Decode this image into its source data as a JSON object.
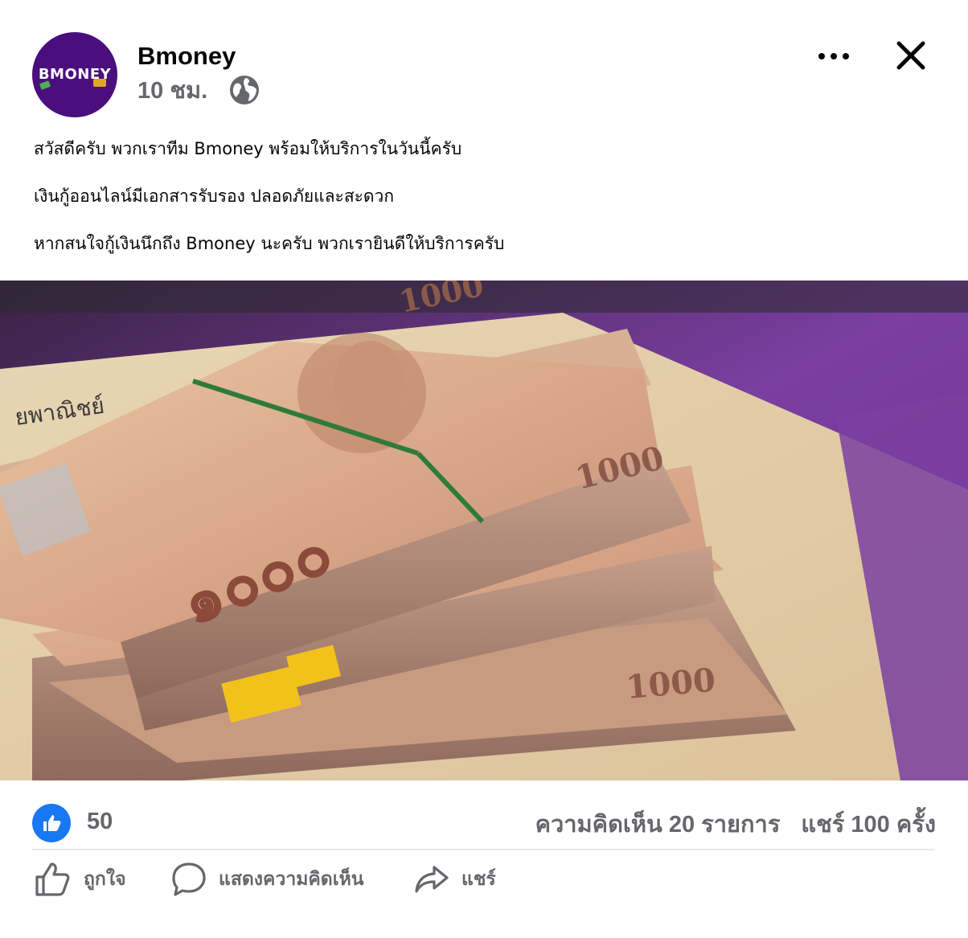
{
  "post": {
    "page_name": "Bmoney",
    "avatar_text": "BMONEY",
    "time": "10 ชม.",
    "privacy_icon": "globe-icon",
    "lines": [
      "สวัสดีครับ พวกเราทีม Bmoney พร้อมให้บริการในวันนี้ครับ",
      "เงินกู้ออนไลน์มีเอกสารรับรอง ปลอดภัยและสะดวก",
      "หากสนใจกู้เงินนึกถึง Bmoney นะครับ พวกเรายินดีให้บริการครับ"
    ]
  },
  "photo": {
    "banknote_label": "1000"
  },
  "stats": {
    "likes": "50",
    "comments": "ความคิดเห็น 20 รายการ",
    "shares": "แชร์ 100 ครั้ง"
  },
  "actions": {
    "like_label": "ถูกใจ",
    "comment_label": "แสดงความคิดเห็น",
    "share_label": "แชร์"
  },
  "colors": {
    "avatar_bg": "#4a0f7d",
    "like_blue": "#1877f2",
    "muted_text": "#65676b"
  },
  "icons": {
    "more": "more-options-icon",
    "close": "close-icon",
    "like": "thumbs-up-icon",
    "comment": "comment-bubble-icon",
    "share": "share-arrow-icon"
  }
}
